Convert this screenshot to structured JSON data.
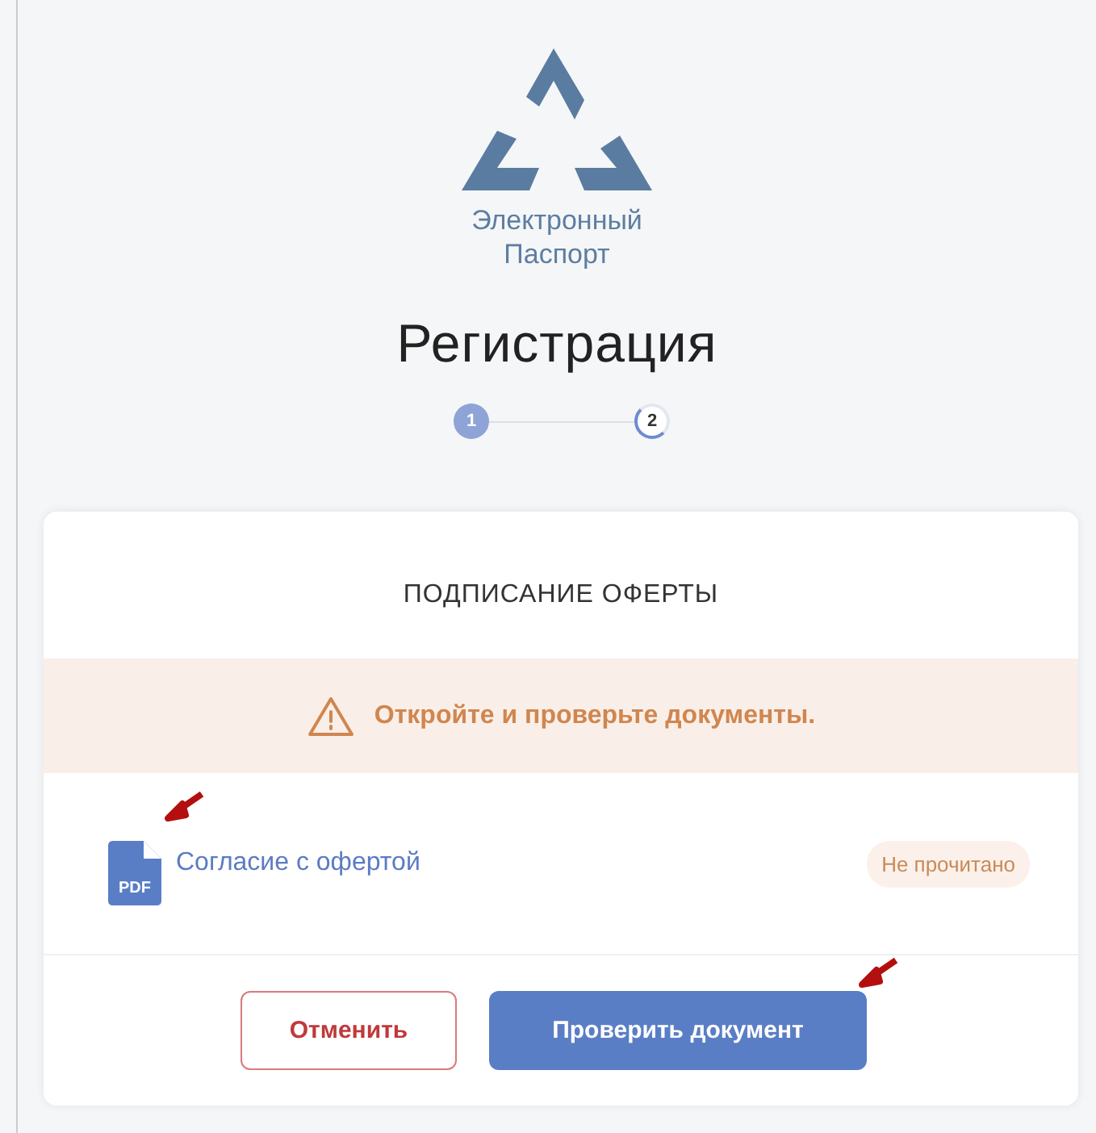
{
  "logo": {
    "text_lines": [
      "Электронный",
      "Паспорт"
    ]
  },
  "title": "Регистрация",
  "steps": [
    {
      "label": "1",
      "selected": true
    },
    {
      "label": "2",
      "selected": false
    }
  ],
  "card": {
    "heading": "ПОДПИСАНИЕ ОФЕРТЫ",
    "warning": "Откройте и проверьте документы.",
    "documents": [
      {
        "file_type": "PDF",
        "name": "Согласие с офертой",
        "status": "Не прочитано"
      }
    ],
    "buttons": [
      {
        "kind": "secondary",
        "label": "Отменить"
      },
      {
        "kind": "primary",
        "label": "Проверить документ"
      }
    ]
  }
}
